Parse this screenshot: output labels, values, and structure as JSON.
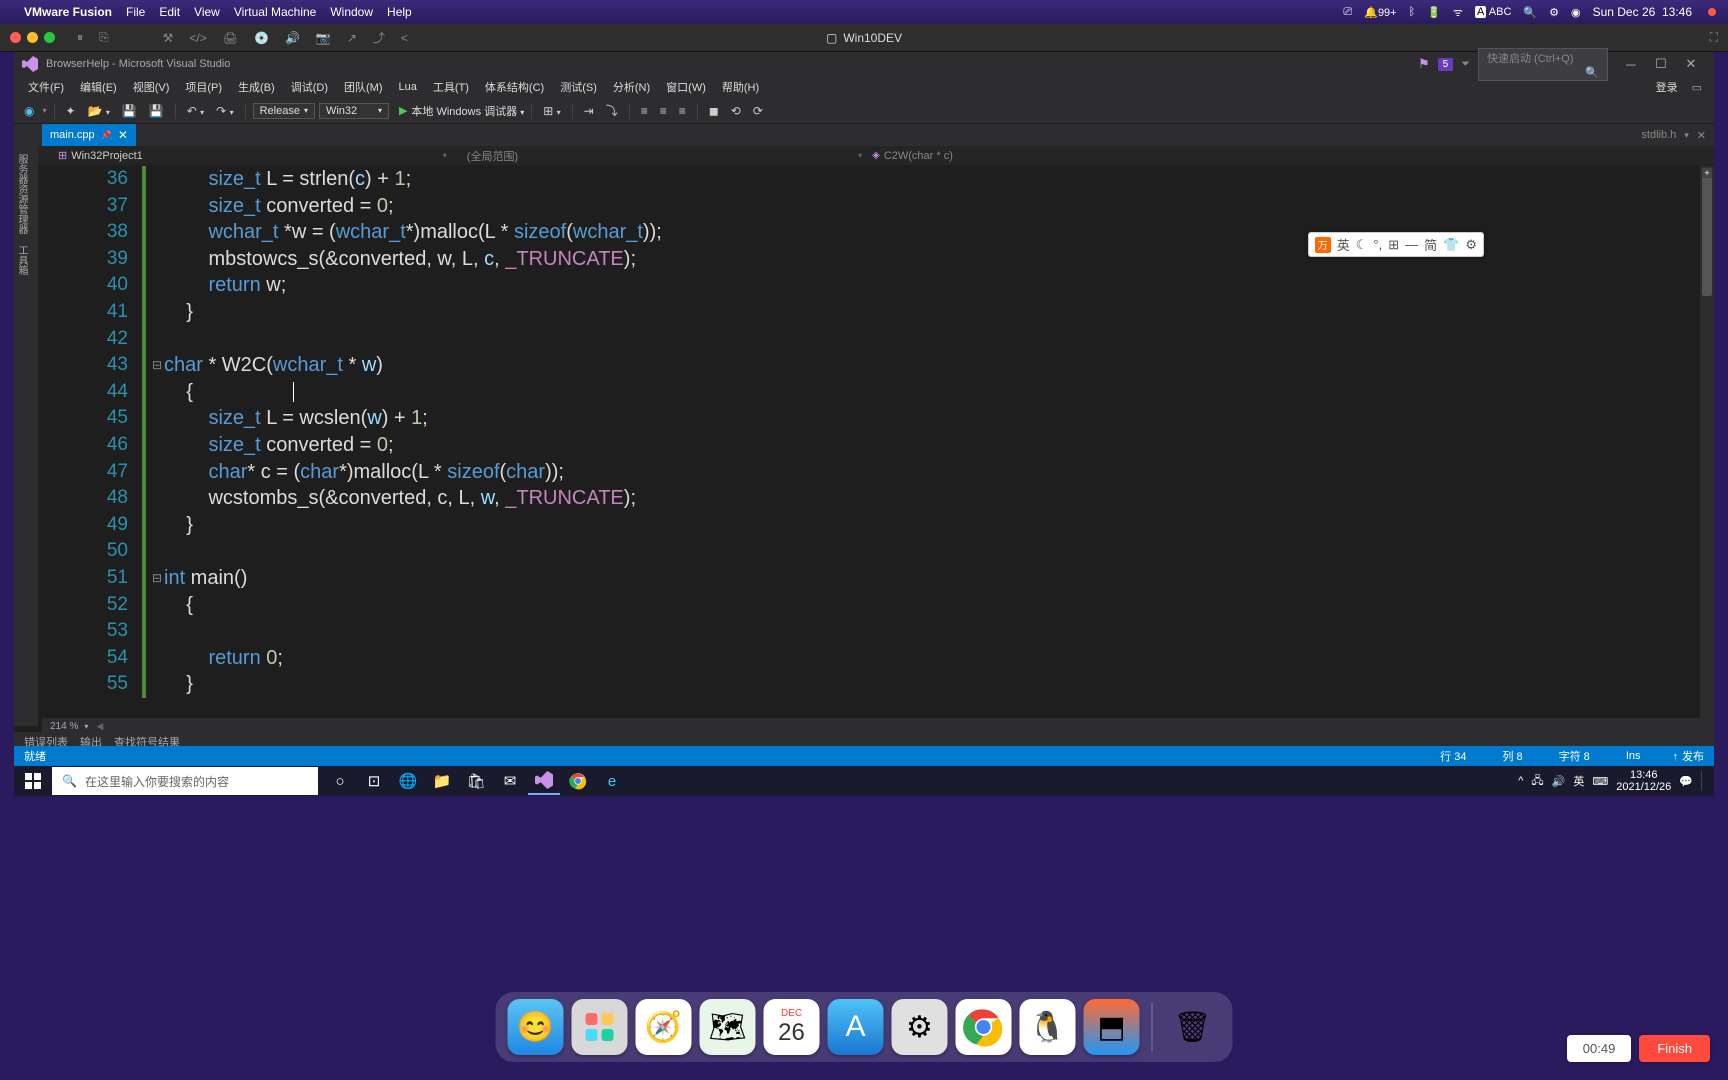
{
  "mac_menu": {
    "app": "VMware Fusion",
    "items": [
      "File",
      "Edit",
      "View",
      "Virtual Machine",
      "Window",
      "Help"
    ]
  },
  "mac_status": {
    "notif": "99+",
    "input_badge": "A",
    "input_label": "ABC",
    "date": "Sun Dec 26",
    "time": "13:46"
  },
  "vmware": {
    "title": "Win10DEV"
  },
  "vs": {
    "title": "BrowserHelp - Microsoft Visual Studio",
    "ext_badge": "5",
    "search_placeholder": "快速启动 (Ctrl+Q)",
    "login": "登录",
    "menu": [
      "文件(F)",
      "编辑(E)",
      "视图(V)",
      "项目(P)",
      "生成(B)",
      "调试(D)",
      "团队(M)",
      "Lua",
      "工具(T)",
      "体系结构(C)",
      "测试(S)",
      "分析(N)",
      "窗口(W)",
      "帮助(H)"
    ],
    "toolbar": {
      "config": "Release",
      "platform": "Win32",
      "debug": "本地 Windows 调试器"
    },
    "tab": {
      "name": "main.cpp"
    },
    "right_header": "stdlib.h",
    "nav": {
      "project": "Win32Project1",
      "scope": "(全局范围)",
      "func": "C2W(char * c)"
    },
    "left_rail": [
      "服务器资源管理器",
      "工具箱"
    ],
    "zoom": "214 %",
    "output_tabs": [
      "错误列表",
      "输出",
      "查找符号结果"
    ],
    "status": {
      "ready": "就绪",
      "line": "行 34",
      "col": "列 8",
      "char": "字符 8",
      "ins": "Ins",
      "publish": "发布"
    }
  },
  "code": {
    "lines": [
      {
        "n": 36,
        "i": 2,
        "t": [
          [
            "k-type",
            "size_t"
          ],
          [
            "",
            " L = strlen("
          ],
          [
            "k-param",
            "c"
          ],
          [
            "",
            ") + "
          ],
          [
            "k-num",
            "1"
          ],
          [
            "",
            ";"
          ]
        ]
      },
      {
        "n": 37,
        "i": 2,
        "t": [
          [
            "k-type",
            "size_t"
          ],
          [
            "",
            " converted = "
          ],
          [
            "k-num",
            "0"
          ],
          [
            "",
            ";"
          ]
        ]
      },
      {
        "n": 38,
        "i": 2,
        "t": [
          [
            "k-type",
            "wchar_t"
          ],
          [
            "",
            " *w = ("
          ],
          [
            "k-type",
            "wchar_t"
          ],
          [
            "",
            "*)malloc(L * "
          ],
          [
            "k-keyword",
            "sizeof"
          ],
          [
            "",
            "("
          ],
          [
            "k-type",
            "wchar_t"
          ],
          [
            "",
            "));"
          ]
        ]
      },
      {
        "n": 39,
        "i": 2,
        "t": [
          [
            "",
            "mbstowcs_s(&converted, w, L, "
          ],
          [
            "k-param",
            "c"
          ],
          [
            "",
            ", "
          ],
          [
            "k-macro",
            "_TRUNCATE"
          ],
          [
            "",
            ");"
          ]
        ]
      },
      {
        "n": 40,
        "i": 2,
        "t": [
          [
            "k-keyword",
            "return"
          ],
          [
            "",
            " w;"
          ]
        ]
      },
      {
        "n": 41,
        "i": 1,
        "t": [
          [
            "",
            "}"
          ]
        ]
      },
      {
        "n": 42,
        "i": 0,
        "t": [
          [
            "",
            ""
          ]
        ]
      },
      {
        "n": 43,
        "i": 0,
        "fold": true,
        "t": [
          [
            "k-type",
            "char"
          ],
          [
            "",
            " * W2C("
          ],
          [
            "k-type",
            "wchar_t"
          ],
          [
            "",
            " * "
          ],
          [
            "k-param",
            "w"
          ],
          [
            "",
            ")"
          ]
        ]
      },
      {
        "n": 44,
        "i": 1,
        "t": [
          [
            "",
            "{"
          ]
        ],
        "caret": true
      },
      {
        "n": 45,
        "i": 2,
        "t": [
          [
            "k-type",
            "size_t"
          ],
          [
            "",
            " L = wcslen("
          ],
          [
            "k-param",
            "w"
          ],
          [
            "",
            ") + "
          ],
          [
            "k-num",
            "1"
          ],
          [
            "",
            ";"
          ]
        ]
      },
      {
        "n": 46,
        "i": 2,
        "t": [
          [
            "k-type",
            "size_t"
          ],
          [
            "",
            " converted = "
          ],
          [
            "k-num",
            "0"
          ],
          [
            "",
            ";"
          ]
        ]
      },
      {
        "n": 47,
        "i": 2,
        "t": [
          [
            "k-type",
            "char"
          ],
          [
            "",
            "* c = ("
          ],
          [
            "k-type",
            "char"
          ],
          [
            "",
            "*)malloc(L * "
          ],
          [
            "k-keyword",
            "sizeof"
          ],
          [
            "",
            "("
          ],
          [
            "k-type",
            "char"
          ],
          [
            "",
            "));"
          ]
        ]
      },
      {
        "n": 48,
        "i": 2,
        "t": [
          [
            "",
            "wcstombs_s(&converted, c, L, "
          ],
          [
            "k-param",
            "w"
          ],
          [
            "",
            ", "
          ],
          [
            "k-macro",
            "_TRUNCATE"
          ],
          [
            "",
            ");"
          ]
        ]
      },
      {
        "n": 49,
        "i": 1,
        "t": [
          [
            "",
            "}"
          ]
        ]
      },
      {
        "n": 50,
        "i": 0,
        "t": [
          [
            "",
            ""
          ]
        ]
      },
      {
        "n": 51,
        "i": 0,
        "fold": true,
        "t": [
          [
            "k-type",
            "int"
          ],
          [
            "",
            " main()"
          ]
        ]
      },
      {
        "n": 52,
        "i": 1,
        "t": [
          [
            "",
            "{"
          ]
        ]
      },
      {
        "n": 53,
        "i": 0,
        "t": [
          [
            "",
            ""
          ]
        ]
      },
      {
        "n": 54,
        "i": 2,
        "t": [
          [
            "k-keyword",
            "return"
          ],
          [
            "",
            " "
          ],
          [
            "k-num",
            "0"
          ],
          [
            "",
            ";"
          ]
        ]
      },
      {
        "n": 55,
        "i": 1,
        "t": [
          [
            "",
            "}"
          ]
        ]
      }
    ]
  },
  "ime": {
    "lang": "英",
    "items": [
      "☾",
      "°,",
      "⊞",
      "—",
      "简",
      "👕",
      "⚙"
    ]
  },
  "win": {
    "search_placeholder": "在这里输入你要搜索的内容",
    "tray": {
      "ime": "英",
      "time": "13:46",
      "date": "2021/12/26"
    }
  },
  "dock": {
    "calendar": {
      "month": "DEC",
      "day": "26"
    }
  },
  "recording": {
    "time": "00:49",
    "finish": "Finish"
  }
}
